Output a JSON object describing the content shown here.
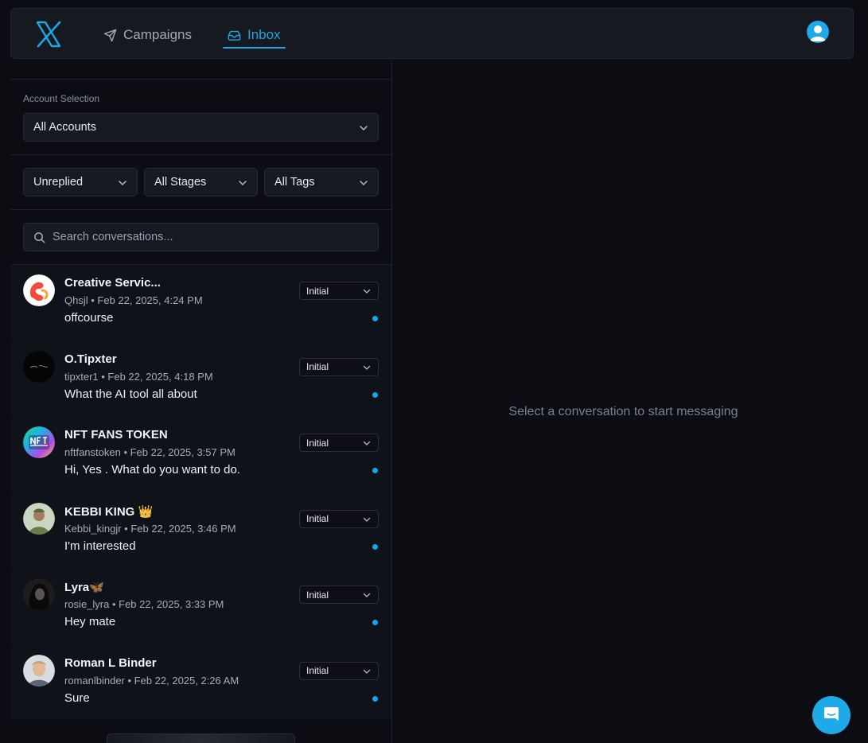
{
  "nav": {
    "campaigns_label": "Campaigns",
    "inbox_label": "Inbox"
  },
  "filters": {
    "account_label": "Account Selection",
    "account_value": "All Accounts",
    "status_value": "Unreplied",
    "stages_value": "All Stages",
    "tags_value": "All Tags"
  },
  "search": {
    "placeholder": "Search conversations..."
  },
  "conversations": [
    {
      "name": "Creative Servic...",
      "meta": "Qhsjl • Feb 22, 2025, 4:24 PM",
      "message": "offcourse",
      "stage": "Initial",
      "unread": true
    },
    {
      "name": "O.Tipxter",
      "meta": "tipxter1 • Feb 22, 2025, 4:18 PM",
      "message": "What the AI tool all about",
      "stage": "Initial",
      "unread": true
    },
    {
      "name": "NFT FANS TOKEN",
      "meta": "nftfanstoken • Feb 22, 2025, 3:57 PM",
      "message": "Hi, Yes . What do you want to do.",
      "stage": "Initial",
      "unread": true
    },
    {
      "name": "KEBBI KING 👑",
      "meta": "Kebbi_kingjr • Feb 22, 2025, 3:46 PM",
      "message": "I'm interested",
      "stage": "Initial",
      "unread": true
    },
    {
      "name": "Lyra🦋",
      "meta": "rosie_lyra • Feb 22, 2025, 3:33 PM",
      "message": "Hey mate",
      "stage": "Initial",
      "unread": true
    },
    {
      "name": "Roman L Binder",
      "meta": "romanlbinder • Feb 22, 2025, 2:26 AM",
      "message": "Sure",
      "stage": "Initial",
      "unread": true
    }
  ],
  "empty_state": "Select a conversation to start messaging",
  "colors": {
    "accent": "#1fa7e3",
    "background": "#0c0d12",
    "unread_dot": "#12a7ea"
  }
}
